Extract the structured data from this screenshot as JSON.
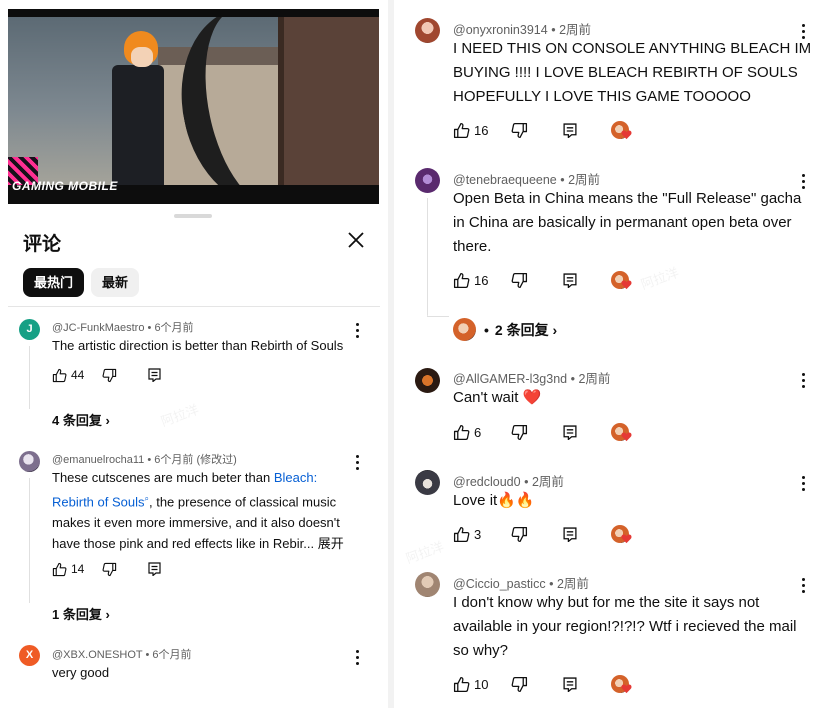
{
  "left": {
    "video": {
      "overlay_text": "GAMING MOBILE"
    },
    "sheet": {
      "title": "评论",
      "chips": [
        "最热门",
        "最新"
      ]
    },
    "comments": [
      {
        "user": "@JC-FunkMaestro",
        "time": "6个月前",
        "edited": "",
        "avatar_letter": "J",
        "avatar_color": "#16a085",
        "lines": [
          "The artistic direction is better than Rebirth of Souls"
        ],
        "likes": "44",
        "replies": "4 条回复"
      },
      {
        "user": "@emanuelrocha11",
        "time": "6个月前",
        "edited": "(修改过)",
        "avatar_letter": "",
        "avatar_color": "#7d6f8e",
        "text_before_link": "These cutscenes are much beter than ",
        "link_text_1": "Bleach:",
        "link_text_2": "Rebirth of Souls",
        "text_after_link": ", the presence of classical music",
        "lines": [
          "makes it even more immersive, and it also doesn't",
          "have those pink and red effects like in Rebir..."
        ],
        "expand": "展开",
        "likes": "14",
        "replies": "1 条回复"
      },
      {
        "user": "@XBX.ONESHOT",
        "time": "6个月前",
        "edited": "",
        "avatar_letter": "X",
        "avatar_color": "#ef5b25",
        "lines": [
          "very good"
        ]
      }
    ]
  },
  "right": {
    "comments": [
      {
        "user": "@onyxronin3914",
        "time": "2周前",
        "avatar_color": "#a0472f",
        "lines": [
          "I NEED THIS ON CONSOLE ANYTHING BLEACH IM",
          "BUYING !!!! I LOVE BLEACH REBIRTH OF SOULS",
          "HOPEFULLY I LOVE THIS GAME TOOOOO"
        ],
        "likes": "16"
      },
      {
        "user": "@tenebraequeene",
        "time": "2周前",
        "avatar_color": "#5a2a6e",
        "lines": [
          "Open Beta in China means the \"Full Release\" gacha",
          "in China are basically in permanant open beta over",
          "there."
        ],
        "likes": "16",
        "replies": "2 条回复"
      },
      {
        "user": "@AllGAMER-l3g3nd",
        "time": "2周前",
        "avatar_color": "#2b1a12",
        "lines": [
          "Can't wait ❤️"
        ],
        "likes": "6"
      },
      {
        "user": "@redcloud0",
        "time": "2周前",
        "avatar_color": "#3a3a44",
        "lines": [
          "Love it🔥🔥"
        ],
        "likes": "3"
      },
      {
        "user": "@Ciccio_pasticc",
        "time": "2周前",
        "avatar_color": "#a08572",
        "lines": [
          "I don't know why but for me the site it says not",
          "available in your region!?!?!? Wtf i recieved the mail",
          "so why?"
        ],
        "likes": "10"
      }
    ],
    "separator": "•"
  },
  "watermark": "阿拉洋",
  "icons": [
    "thumbs-up-icon",
    "thumbs-down-icon",
    "reply-icon",
    "more-vert-icon",
    "close-icon",
    "heart-icon"
  ]
}
